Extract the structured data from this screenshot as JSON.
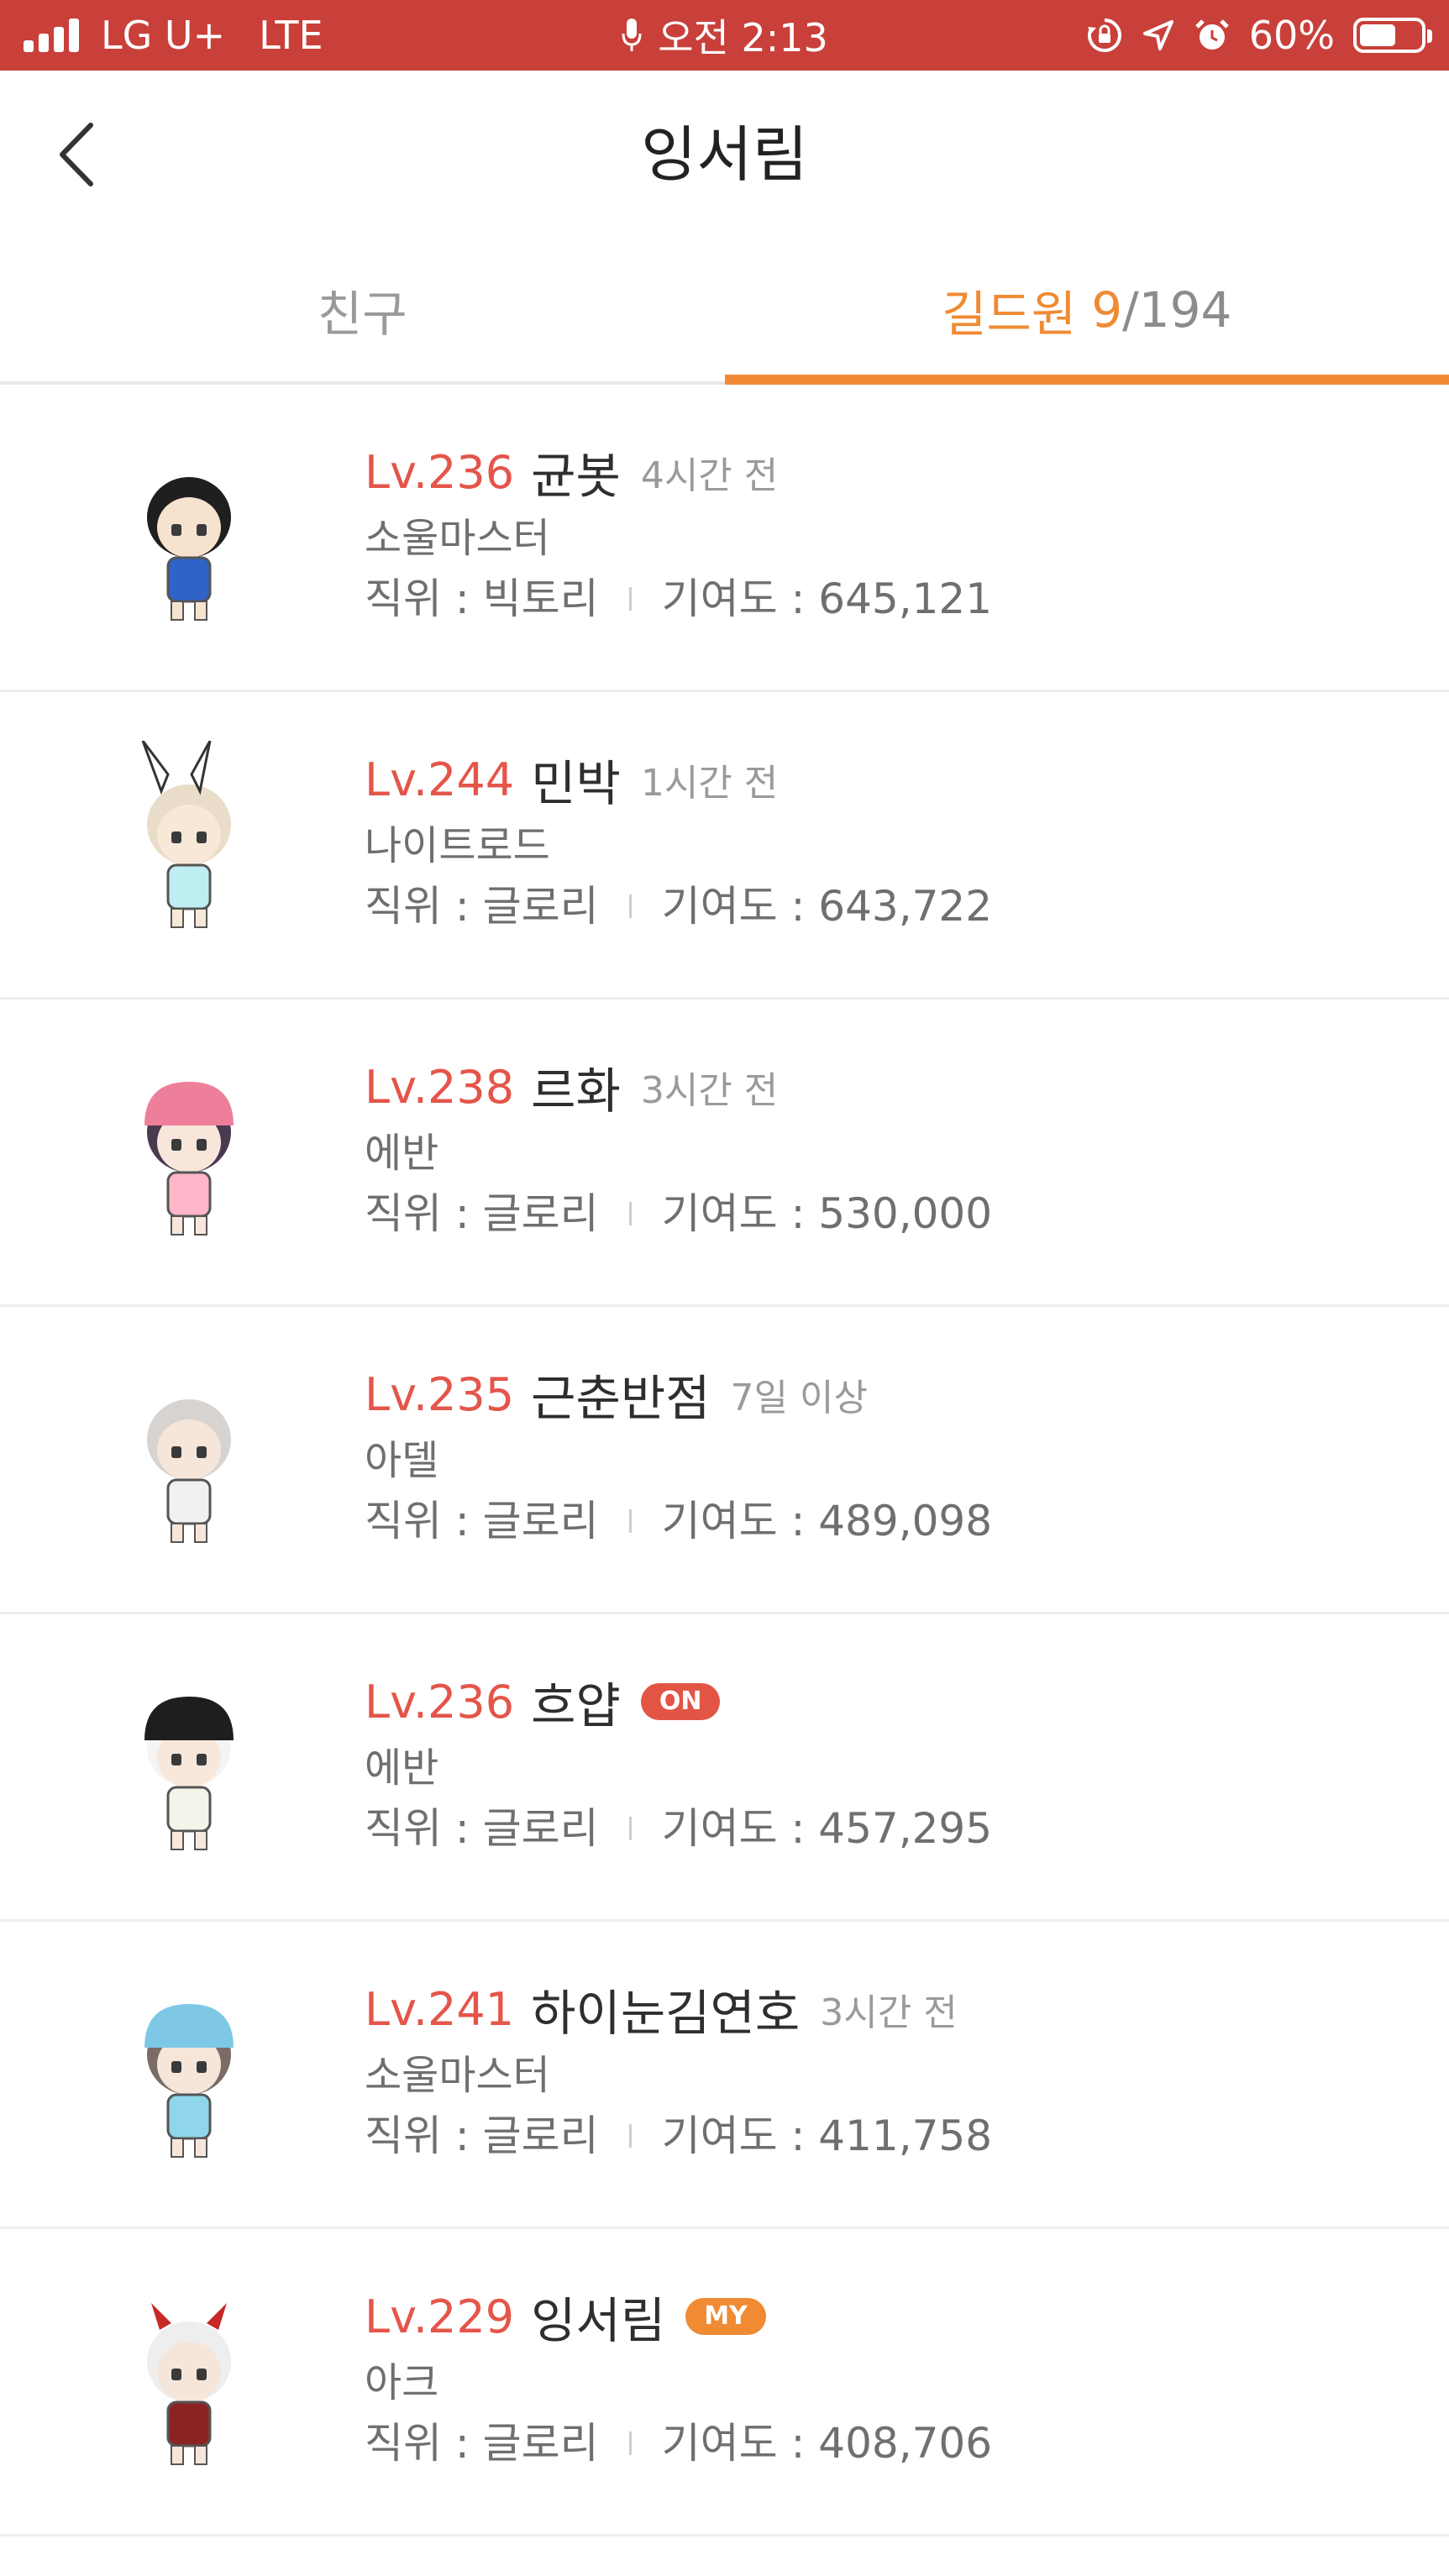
{
  "status_bar": {
    "carrier": "LG U+",
    "network": "LTE",
    "time": "오전 2:13",
    "battery": "60%",
    "battery_level": 0.6,
    "color": "#c9403a"
  },
  "header": {
    "back_icon": "chevron-left-icon",
    "title": "잉서림"
  },
  "tabs": {
    "friends": "친구",
    "guild_label": "길드원",
    "guild_online": "9",
    "guild_total": "/194",
    "accent_color": "#f28a35"
  },
  "members": [
    {
      "level": "Lv.236",
      "name": "균봇",
      "last_seen": "4시간 전",
      "job": "소울마스터",
      "rank_label": "직위 : 빅토리",
      "contribution_label": "기여도 : 645,121"
    },
    {
      "level": "Lv.244",
      "name": "민박",
      "last_seen": "1시간 전",
      "job": "나이트로드",
      "rank_label": "직위 : 글로리",
      "contribution_label": "기여도 : 643,722"
    },
    {
      "level": "Lv.238",
      "name": "르화",
      "last_seen": "3시간 전",
      "job": "에반",
      "rank_label": "직위 : 글로리",
      "contribution_label": "기여도 : 530,000"
    },
    {
      "level": "Lv.235",
      "name": "근춘반점",
      "last_seen": "7일 이상",
      "job": "아델",
      "rank_label": "직위 : 글로리",
      "contribution_label": "기여도 : 489,098"
    },
    {
      "level": "Lv.236",
      "name": "흐얍",
      "badge": "ON",
      "badge_color": "#e25545",
      "job": "에반",
      "rank_label": "직위 : 글로리",
      "contribution_label": "기여도 : 457,295"
    },
    {
      "level": "Lv.241",
      "name": "하이눈김연호",
      "last_seen": "3시간 전",
      "job": "소울마스터",
      "rank_label": "직위 : 글로리",
      "contribution_label": "기여도 : 411,758"
    },
    {
      "level": "Lv.229",
      "name": "잉서림",
      "badge": "MY",
      "badge_color": "#f08a33",
      "job": "아크",
      "rank_label": "직위 : 글로리",
      "contribution_label": "기여도 : 408,706"
    }
  ]
}
